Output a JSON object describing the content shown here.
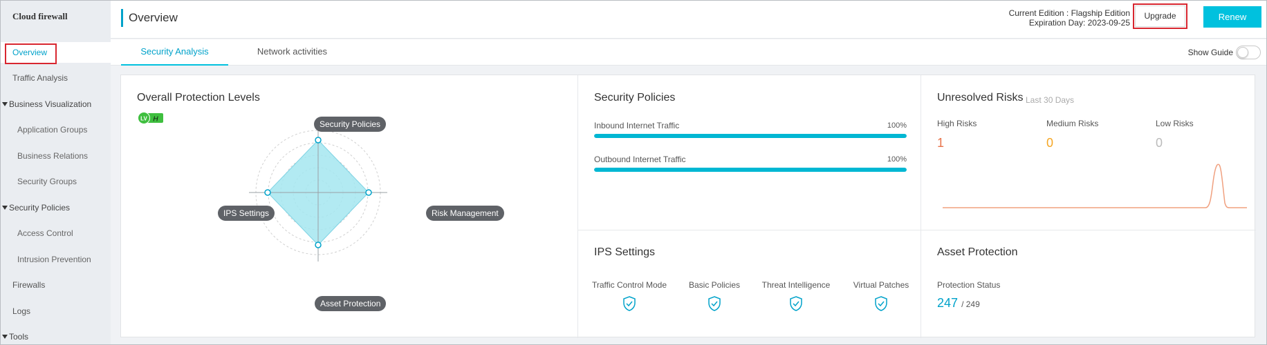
{
  "app": {
    "brand": "Cloud firewall"
  },
  "sidebar": {
    "items": [
      {
        "label": "Overview"
      },
      {
        "label": "Traffic Analysis"
      },
      {
        "label": "Business Visualization"
      },
      {
        "label": "Application Groups"
      },
      {
        "label": "Business Relations"
      },
      {
        "label": "Security Groups"
      },
      {
        "label": "Security Policies"
      },
      {
        "label": "Access Control"
      },
      {
        "label": "Intrusion Prevention"
      },
      {
        "label": "Firewalls"
      },
      {
        "label": "Logs"
      },
      {
        "label": "Tools"
      }
    ]
  },
  "header": {
    "title": "Overview",
    "edition_line": "Current Edition : Flagship Edition",
    "expiry_line": "Expiration Day: 2023-09-25",
    "upgrade_label": "Upgrade",
    "renew_label": "Renew"
  },
  "tabs": [
    {
      "label": "Security Analysis"
    },
    {
      "label": "Network activities"
    }
  ],
  "show_guide_label": "Show Guide",
  "protection": {
    "title": "Overall Protection Levels",
    "badge_lv": "LV",
    "badge_level": "H",
    "axes": {
      "top": "Security Policies",
      "left": "IPS Settings",
      "right": "Risk Management",
      "bottom": "Asset Protection"
    }
  },
  "security_policies": {
    "title": "Security Policies",
    "rows": [
      {
        "label": "Inbound Internet Traffic",
        "pct_text": "100%",
        "value": 100
      },
      {
        "label": "Outbound Internet Traffic",
        "pct_text": "100%",
        "value": 100
      }
    ]
  },
  "risks": {
    "title": "Unresolved Risks",
    "period": "Last 30 Days",
    "high_label": "High Risks",
    "high_value": "1",
    "medium_label": "Medium Risks",
    "medium_value": "0",
    "low_label": "Low Risks",
    "low_value": "0"
  },
  "ips": {
    "title": "IPS Settings",
    "items": [
      {
        "label": "Traffic Control Mode"
      },
      {
        "label": "Basic Policies"
      },
      {
        "label": "Threat Intelligence"
      },
      {
        "label": "Virtual Patches"
      }
    ]
  },
  "asset": {
    "title": "Asset Protection",
    "status_label": "Protection Status",
    "protected": "247",
    "total": "/ 249"
  },
  "colors": {
    "accent": "#00c1de",
    "link": "#00a2ca",
    "high": "#e8734a",
    "medium": "#f5a623",
    "low": "#bbbbbb",
    "highlight": "#d8262f"
  }
}
